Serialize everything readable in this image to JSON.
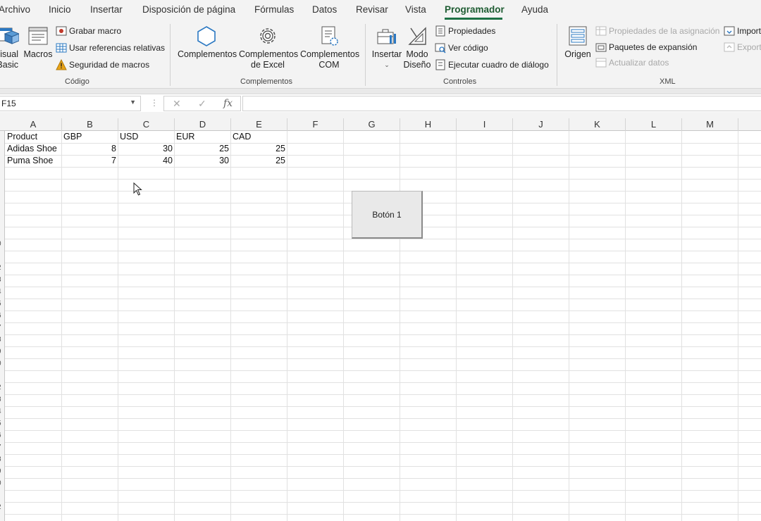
{
  "ribbon_tabs": [
    {
      "label": "Archivo"
    },
    {
      "label": "Inicio"
    },
    {
      "label": "Insertar"
    },
    {
      "label": "Disposición de página"
    },
    {
      "label": "Fórmulas"
    },
    {
      "label": "Datos"
    },
    {
      "label": "Revisar"
    },
    {
      "label": "Vista"
    },
    {
      "label": "Programador",
      "active": true
    },
    {
      "label": "Ayuda"
    }
  ],
  "groups": {
    "codigo": {
      "label": "Código",
      "visual_basic": "Visual\nBasic",
      "visual_basic_l1": "Visual",
      "visual_basic_l2": "Basic",
      "macros": "Macros",
      "grabar_macro": "Grabar macro",
      "usar_referencias": "Usar referencias relativas",
      "seguridad_macros": "Seguridad de macros"
    },
    "complementos": {
      "label": "Complementos",
      "complementos": "Complementos",
      "complementos_excel_l1": "Complementos",
      "complementos_excel_l2": "de Excel",
      "complementos_com_l1": "Complementos",
      "complementos_com_l2": "COM"
    },
    "controles": {
      "label": "Controles",
      "insertar": "Insertar",
      "modo_l1": "Modo",
      "modo_l2": "Diseño",
      "propiedades": "Propiedades",
      "ver_codigo": "Ver código",
      "ejecutar_dialogo": "Ejecutar cuadro de diálogo"
    },
    "xml": {
      "label": "XML",
      "origen": "Origen",
      "propiedades_asignacion": "Propiedades de la asignación",
      "paquetes_expansion": "Paquetes de expansión",
      "actualizar_datos": "Actualizar datos",
      "importar": "Import",
      "exportar": "Export"
    }
  },
  "formula_bar": {
    "name_box": "F15",
    "fx": "fx",
    "value": ""
  },
  "columns": [
    "A",
    "B",
    "C",
    "D",
    "E",
    "F",
    "G",
    "H",
    "I",
    "J",
    "K",
    "L",
    "M"
  ],
  "table": {
    "headers": [
      "Product",
      "GBP",
      "USD",
      "EUR",
      "CAD"
    ],
    "rows": [
      {
        "product": "Adidas Shoe",
        "gbp": "8",
        "usd": "30",
        "eur": "25",
        "cad": "25"
      },
      {
        "product": "Puma Shoe",
        "gbp": "7",
        "usd": "40",
        "eur": "30",
        "cad": "25"
      }
    ]
  },
  "form_button": {
    "label": "Botón 1"
  },
  "row_numbers": [
    "0",
    "2",
    "3",
    "4",
    "5",
    "6",
    "7",
    "8",
    "9",
    "0",
    "2",
    "3",
    "4",
    "5",
    "6",
    "7",
    "8",
    "9",
    "0",
    "2"
  ],
  "colors": {
    "accent": "#1e7145",
    "ribbon_bg": "#f3f3f3",
    "gridline": "#e1e1e1",
    "warning": "#e8a317",
    "blue_icon": "#2b78c2"
  }
}
